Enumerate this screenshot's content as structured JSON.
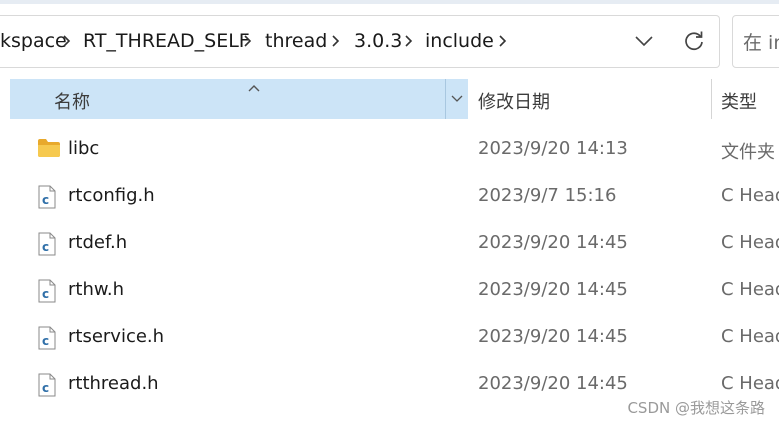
{
  "breadcrumb": {
    "items": [
      "kspace",
      "RT_THREAD_SELF",
      "thread",
      "3.0.3",
      "include"
    ]
  },
  "address_controls": {
    "history_dropdown_icon": "chevron-down-icon",
    "refresh_icon": "refresh-icon"
  },
  "search": {
    "placeholder": "在 in"
  },
  "columns": {
    "name": "名称",
    "date": "修改日期",
    "type": "类型"
  },
  "colors": {
    "selected_header": "#cce4f7",
    "folder": "#f4c14d",
    "c_file_icon": "#2f6fa8"
  },
  "files": [
    {
      "name": "libc",
      "date": "2023/9/20 14:13",
      "type": "文件夹",
      "icon": "folder-icon"
    },
    {
      "name": "rtconfig.h",
      "date": "2023/9/7 15:16",
      "type": "C Head",
      "icon": "c-file-icon"
    },
    {
      "name": "rtdef.h",
      "date": "2023/9/20 14:45",
      "type": "C Head",
      "icon": "c-file-icon"
    },
    {
      "name": "rthw.h",
      "date": "2023/9/20 14:45",
      "type": "C Head",
      "icon": "c-file-icon"
    },
    {
      "name": "rtservice.h",
      "date": "2023/9/20 14:45",
      "type": "C Head",
      "icon": "c-file-icon"
    },
    {
      "name": "rtthread.h",
      "date": "2023/9/20 14:45",
      "type": "C Head",
      "icon": "c-file-icon"
    }
  ],
  "watermark": "CSDN @我想这条路"
}
